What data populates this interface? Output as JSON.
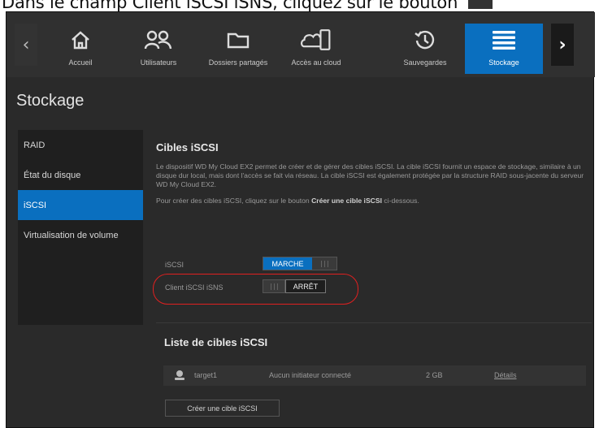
{
  "instruction": {
    "text": "Dans le champ Client iSCSI iSNS, cliquez sur le bouton"
  },
  "nav": {
    "items": [
      {
        "label": "Accueil",
        "icon": "home-icon"
      },
      {
        "label": "Utilisateurs",
        "icon": "users-icon"
      },
      {
        "label": "Dossiers partagés",
        "icon": "folder-icon"
      },
      {
        "label": "Accès au cloud",
        "icon": "cloud-device-icon"
      },
      {
        "label": "Sauvegardes",
        "icon": "backup-icon"
      },
      {
        "label": "Stockage",
        "icon": "storage-icon",
        "active": true
      }
    ],
    "accent": "#0a6fbf"
  },
  "page": {
    "title": "Stockage"
  },
  "sidebar": {
    "items": [
      {
        "label": "RAID"
      },
      {
        "label": "État du disque"
      },
      {
        "label": "iSCSI",
        "active": true
      },
      {
        "label": "Virtualisation de volume"
      }
    ]
  },
  "main": {
    "section_title": "Cibles iSCSI",
    "description": "Le dispositif WD My Cloud EX2 permet de créer et de gérer des cibles iSCSI. La cible iSCSI fournit un espace de stockage, similaire à un disque dur local, mais dont l'accès se fait via réseau. La cible iSCSI est également protégée par la structure RAID sous-jacente du serveur WD My Cloud EX2.",
    "hint_prefix": "Pour créer des cibles iSCSI, cliquez sur le bouton",
    "hint_bold": "Créer une cible iSCSI",
    "hint_suffix": "ci-dessous.",
    "iscsi_label": "iSCSI",
    "iscsi_toggle": "MARCHE",
    "isns_label": "Client iSCSI iSNS",
    "isns_toggle": "ARRÊT",
    "grip": "|||"
  },
  "targets": {
    "title": "Liste de cibles iSCSI",
    "rows": [
      {
        "name": "target1",
        "status": "Aucun initiateur connecté",
        "size": "2 GB",
        "details": "Détails"
      }
    ],
    "create_button": "Créer une cible iSCSI"
  }
}
